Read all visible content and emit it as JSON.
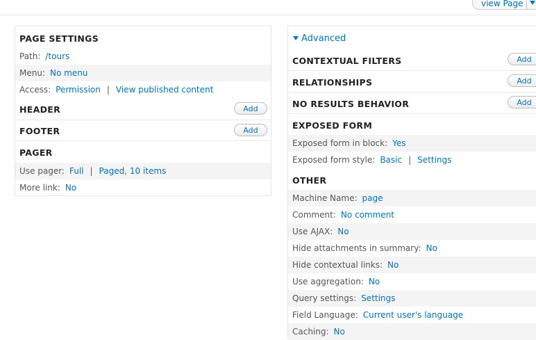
{
  "top": {
    "view_page_label": "view Page"
  },
  "left": {
    "page_settings": {
      "title": "PAGE SETTINGS",
      "path_label": "Path:",
      "path_value": "/tours",
      "menu_label": "Menu:",
      "menu_value": "No menu",
      "access_label": "Access:",
      "access_value": "Permission",
      "access_value2": "View published content"
    },
    "header": {
      "title": "HEADER",
      "add_label": "Add"
    },
    "footer": {
      "title": "FOOTER",
      "add_label": "Add"
    },
    "pager": {
      "title": "PAGER",
      "use_pager_label": "Use pager:",
      "use_pager_value": "Full",
      "use_pager_value2": "Paged, 10 items",
      "more_link_label": "More link:",
      "more_link_value": "No"
    }
  },
  "right": {
    "advanced_label": "Advanced",
    "contextual_filters": {
      "title": "CONTEXTUAL FILTERS",
      "add_label": "Add"
    },
    "relationships": {
      "title": "RELATIONSHIPS",
      "add_label": "Add"
    },
    "no_results": {
      "title": "NO RESULTS BEHAVIOR",
      "add_label": "Add"
    },
    "exposed_form": {
      "title": "EXPOSED FORM",
      "in_block_label": "Exposed form in block:",
      "in_block_value": "Yes",
      "style_label": "Exposed form style:",
      "style_value": "Basic",
      "style_value2": "Settings"
    },
    "other": {
      "title": "OTHER",
      "rows": [
        {
          "label": "Machine Name:",
          "value": "page"
        },
        {
          "label": "Comment:",
          "value": "No comment"
        },
        {
          "label": "Use AJAX:",
          "value": "No"
        },
        {
          "label": "Hide attachments in summary:",
          "value": "No"
        },
        {
          "label": "Hide contextual links:",
          "value": "No"
        },
        {
          "label": "Use aggregation:",
          "value": "No"
        },
        {
          "label": "Query settings:",
          "value": "Settings"
        },
        {
          "label": "Field Language:",
          "value": "Current user's language"
        },
        {
          "label": "Caching:",
          "value": "No"
        }
      ]
    }
  }
}
